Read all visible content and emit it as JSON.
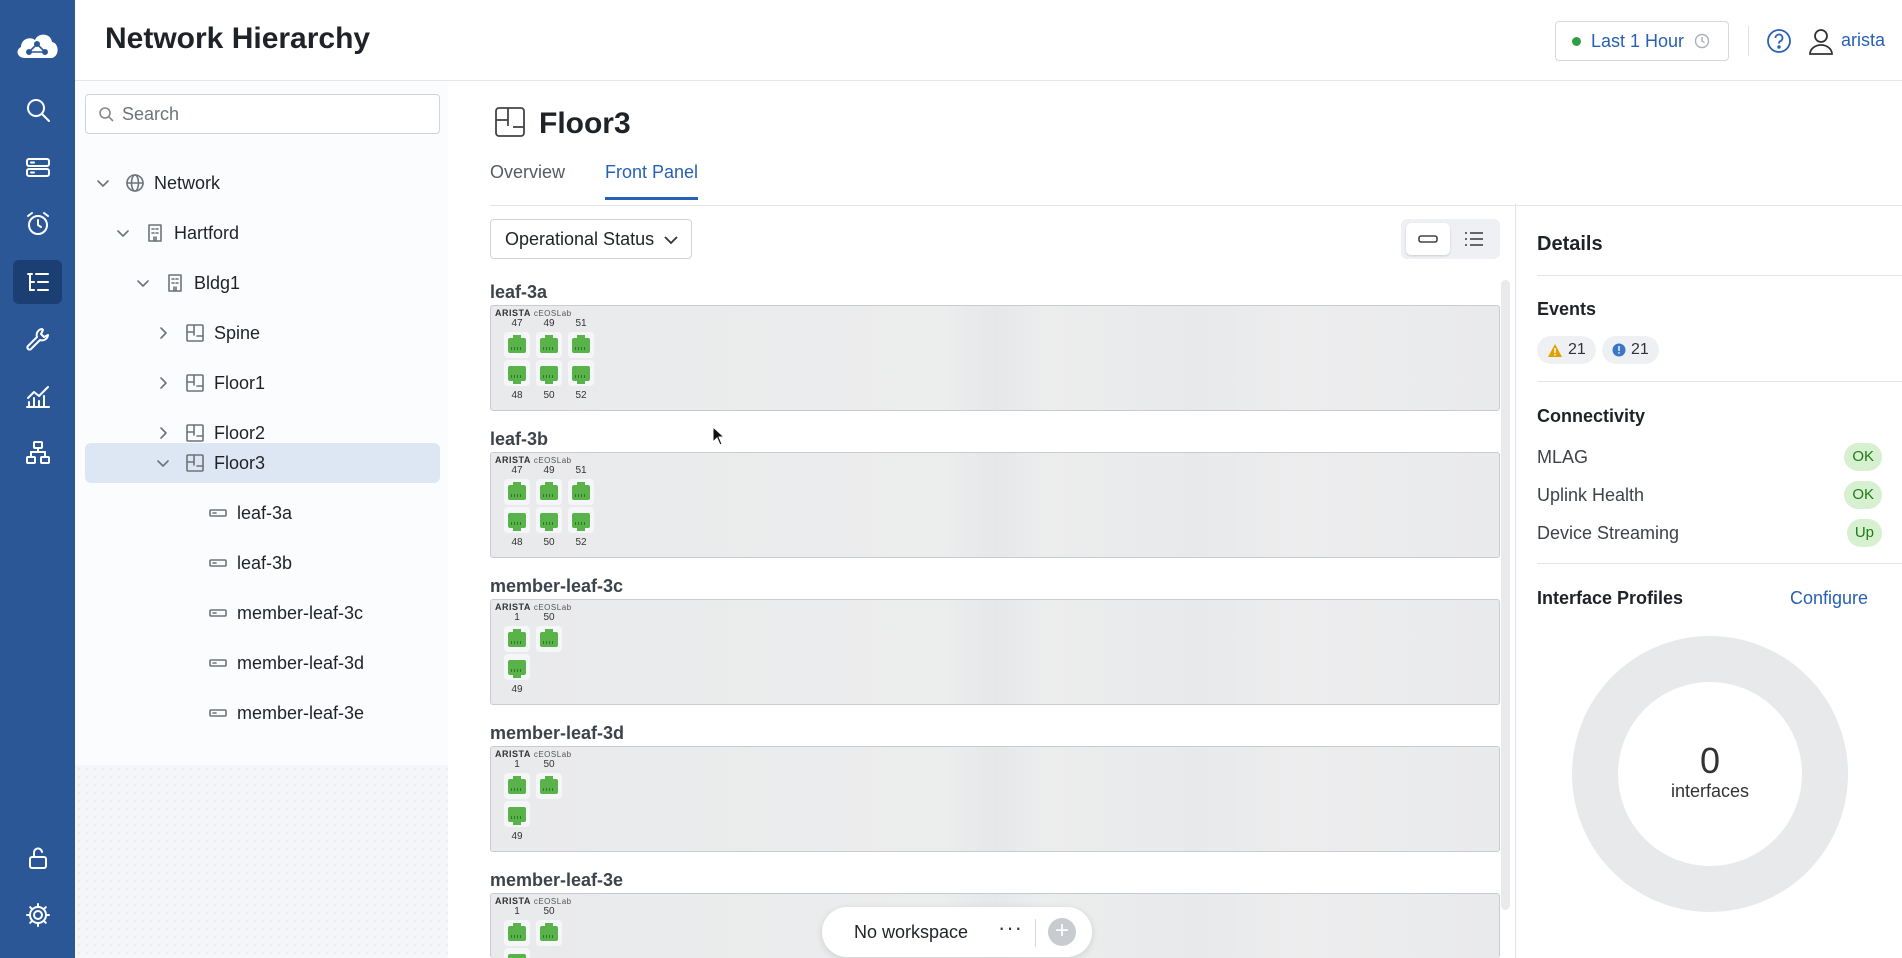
{
  "app": {
    "logo": "cloud-network-logo"
  },
  "header": {
    "title": "Network Hierarchy",
    "time_range": "Last 1 Hour",
    "user": "arista"
  },
  "colors": {
    "rail": "#2b5797",
    "accent": "#2860b4",
    "ok": "#1f7a17",
    "port_green": "#5ab34a"
  },
  "rail_icons": [
    "search-icon",
    "devices-icon",
    "alarm-icon",
    "hierarchy-icon",
    "wrench-icon",
    "analytics-icon",
    "topology-icon",
    "unlock-icon",
    "gear-icon"
  ],
  "tree": {
    "search_placeholder": "Search",
    "nodes": [
      {
        "label": "Network",
        "icon": "globe-icon",
        "expanded": true
      },
      {
        "label": "Hartford",
        "icon": "building-icon",
        "expanded": true
      },
      {
        "label": "Bldg1",
        "icon": "building-icon",
        "expanded": true
      },
      {
        "label": "Spine",
        "icon": "floor-icon",
        "expanded": false
      },
      {
        "label": "Floor1",
        "icon": "floor-icon",
        "expanded": false
      },
      {
        "label": "Floor2",
        "icon": "floor-icon",
        "expanded": false
      },
      {
        "label": "Floor3",
        "icon": "floor-icon",
        "expanded": true,
        "selected": true
      },
      {
        "label": "leaf-3a",
        "icon": "device-icon"
      },
      {
        "label": "leaf-3b",
        "icon": "device-icon"
      },
      {
        "label": "member-leaf-3c",
        "icon": "device-icon"
      },
      {
        "label": "member-leaf-3d",
        "icon": "device-icon"
      },
      {
        "label": "member-leaf-3e",
        "icon": "device-icon"
      }
    ]
  },
  "main": {
    "title": "Floor3",
    "tabs": [
      {
        "label": "Overview",
        "active": false
      },
      {
        "label": "Front Panel",
        "active": true
      }
    ],
    "status_dropdown": "Operational Status",
    "brand": "ARISTA",
    "model": "cEOSLab",
    "devices": [
      {
        "name": "leaf-3a",
        "top_ports": [
          "47",
          "49",
          "51"
        ],
        "bottom_ports": [
          "48",
          "50",
          "52"
        ]
      },
      {
        "name": "leaf-3b",
        "top_ports": [
          "47",
          "49",
          "51"
        ],
        "bottom_ports": [
          "48",
          "50",
          "52"
        ]
      },
      {
        "name": "member-leaf-3c",
        "top_ports": [
          "1",
          "50"
        ],
        "bottom_ports": [
          "49"
        ]
      },
      {
        "name": "member-leaf-3d",
        "top_ports": [
          "1",
          "50"
        ],
        "bottom_ports": [
          "49"
        ]
      },
      {
        "name": "member-leaf-3e",
        "top_ports": [
          "1",
          "50"
        ],
        "bottom_ports": []
      }
    ]
  },
  "workspace": {
    "label": "No workspace",
    "more": "···",
    "add": "+"
  },
  "details": {
    "title": "Details",
    "events": {
      "title": "Events",
      "warnings": "21",
      "info": "21"
    },
    "connectivity": {
      "title": "Connectivity",
      "rows": [
        {
          "label": "MLAG",
          "status": "OK"
        },
        {
          "label": "Uplink Health",
          "status": "OK"
        },
        {
          "label": "Device Streaming",
          "status": "Up"
        }
      ]
    },
    "interface_profiles": {
      "title": "Interface Profiles",
      "configure": "Configure",
      "count": "0",
      "unit": "interfaces"
    }
  }
}
